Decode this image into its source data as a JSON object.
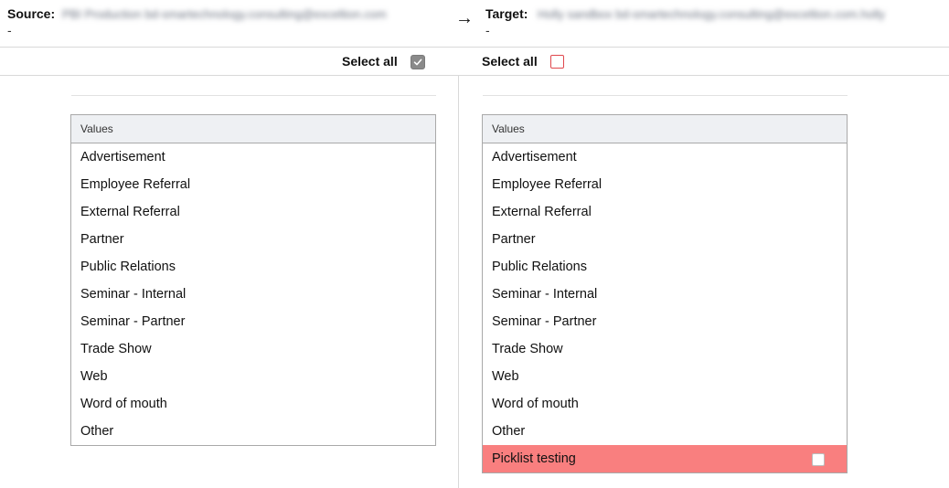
{
  "header": {
    "source_label": "Source:",
    "source_value": "PBI Production bd-smartechnology.consulting@exceltion.com",
    "source_sub": "-",
    "arrow": "→",
    "target_label": "Target:",
    "target_value": "Holly sandbox bd-smartechnology.consulting@exceltion.com.holly",
    "target_sub": "-"
  },
  "left_panel": {
    "select_all_label": "Select all",
    "select_all_checked": true,
    "column_header": "Values",
    "values": [
      "Advertisement",
      "Employee Referral",
      "External Referral",
      "Partner",
      "Public Relations",
      "Seminar - Internal",
      "Seminar - Partner",
      "Trade Show",
      "Web",
      "Word of mouth",
      "Other"
    ]
  },
  "right_panel": {
    "select_all_label": "Select all",
    "select_all_checked": false,
    "column_header": "Values",
    "values": [
      "Advertisement",
      "Employee Referral",
      "External Referral",
      "Partner",
      "Public Relations",
      "Seminar - Internal",
      "Seminar - Partner",
      "Trade Show",
      "Web",
      "Word of mouth",
      "Other"
    ],
    "new_value": "Picklist testing",
    "new_value_checked": false
  },
  "colors": {
    "highlight_row": "#f97f7f",
    "unchecked_border": "#e0474c",
    "checked_fill": "#8a8a8a"
  }
}
